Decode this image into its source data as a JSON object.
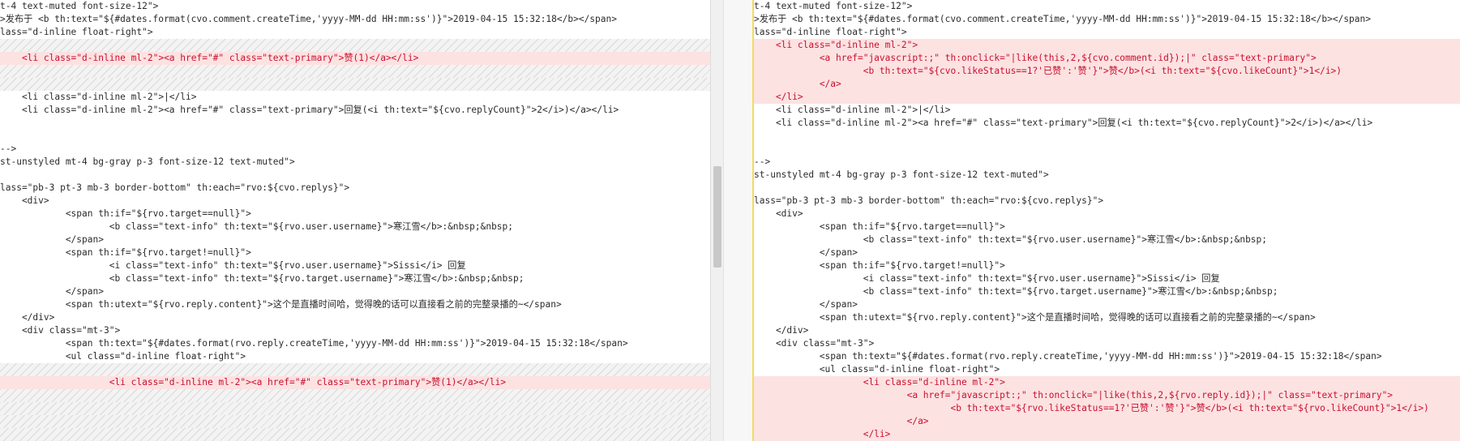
{
  "colors": {
    "changed_bg": "#fde2e2",
    "changed_text": "#c8102e",
    "divider": "#f2dc5d",
    "arrow": "#e7c23a"
  },
  "icons": {
    "merge_arrow_1": "arrow-left-icon",
    "merge_arrow_2": "arrow-left-icon"
  },
  "left": {
    "lines": [
      {
        "text": "t-4 text-muted font-size-12\">",
        "type": "normal"
      },
      {
        "text": ">发布于 <b th:text=\"${#dates.format(cvo.comment.createTime,'yyyy-MM-dd HH:mm:ss')}\">2019-04-15 15:32:18</b></span>",
        "type": "normal"
      },
      {
        "text": "lass=\"d-inline float-right\">",
        "type": "normal"
      },
      {
        "text": "",
        "type": "placeholder"
      },
      {
        "text": "    <li class=\"d-inline ml-2\"><a href=\"#\" class=\"text-primary\">赞(1)</a></li>",
        "type": "changed"
      },
      {
        "text": "",
        "type": "placeholder"
      },
      {
        "text": "",
        "type": "placeholder"
      },
      {
        "text": "    <li class=\"d-inline ml-2\">|</li>",
        "type": "normal"
      },
      {
        "text": "    <li class=\"d-inline ml-2\"><a href=\"#\" class=\"text-primary\">回复(<i th:text=\"${cvo.replyCount}\">2</i>)</a></li>",
        "type": "normal"
      },
      {
        "text": "",
        "type": "normal"
      },
      {
        "text": "",
        "type": "normal"
      },
      {
        "text": "-->",
        "type": "normal"
      },
      {
        "text": "st-unstyled mt-4 bg-gray p-3 font-size-12 text-muted\">",
        "type": "normal"
      },
      {
        "text": "",
        "type": "normal"
      },
      {
        "text": "lass=\"pb-3 pt-3 mb-3 border-bottom\" th:each=\"rvo:${cvo.replys}\">",
        "type": "normal"
      },
      {
        "text": "    <div>",
        "type": "normal"
      },
      {
        "text": "            <span th:if=\"${rvo.target==null}\">",
        "type": "normal"
      },
      {
        "text": "                    <b class=\"text-info\" th:text=\"${rvo.user.username}\">寒江雪</b>:&nbsp;&nbsp;",
        "type": "normal"
      },
      {
        "text": "            </span>",
        "type": "normal"
      },
      {
        "text": "            <span th:if=\"${rvo.target!=null}\">",
        "type": "normal"
      },
      {
        "text": "                    <i class=\"text-info\" th:text=\"${rvo.user.username}\">Sissi</i> 回复",
        "type": "normal"
      },
      {
        "text": "                    <b class=\"text-info\" th:text=\"${rvo.target.username}\">寒江雪</b>:&nbsp;&nbsp;",
        "type": "normal"
      },
      {
        "text": "            </span>",
        "type": "normal"
      },
      {
        "text": "            <span th:utext=\"${rvo.reply.content}\">这个是直播时间哈，觉得晚的话可以直接看之前的完整录播的~</span>",
        "type": "normal"
      },
      {
        "text": "    </div>",
        "type": "normal"
      },
      {
        "text": "    <div class=\"mt-3\">",
        "type": "normal"
      },
      {
        "text": "            <span th:text=\"${#dates.format(rvo.reply.createTime,'yyyy-MM-dd HH:mm:ss')}\">2019-04-15 15:32:18</span>",
        "type": "normal"
      },
      {
        "text": "            <ul class=\"d-inline float-right\">",
        "type": "normal"
      },
      {
        "text": "",
        "type": "placeholder"
      },
      {
        "text": "                    <li class=\"d-inline ml-2\"><a href=\"#\" class=\"text-primary\">赞(1)</a></li>",
        "type": "changed"
      },
      {
        "text": "",
        "type": "placeholder"
      },
      {
        "text": "",
        "type": "placeholder"
      },
      {
        "text": "",
        "type": "placeholder"
      },
      {
        "text": "",
        "type": "placeholder"
      }
    ]
  },
  "right": {
    "lines": [
      {
        "text": "t-4 text-muted font-size-12\">",
        "type": "normal"
      },
      {
        "text": ">发布于 <b th:text=\"${#dates.format(cvo.comment.createTime,'yyyy-MM-dd HH:mm:ss')}\">2019-04-15 15:32:18</b></span>",
        "type": "normal"
      },
      {
        "text": "lass=\"d-inline float-right\">",
        "type": "normal"
      },
      {
        "text": "    <li class=\"d-inline ml-2\">",
        "type": "changed"
      },
      {
        "text": "            <a href=\"javascript:;\" th:onclick=\"|like(this,2,${cvo.comment.id});|\" class=\"text-primary\">",
        "type": "changed"
      },
      {
        "text": "                    <b th:text=\"${cvo.likeStatus==1?'已赞':'赞'}\">赞</b>(<i th:text=\"${cvo.likeCount}\">1</i>)",
        "type": "changed"
      },
      {
        "text": "            </a>",
        "type": "changed"
      },
      {
        "text": "    </li>",
        "type": "changed"
      },
      {
        "text": "    <li class=\"d-inline ml-2\">|</li>",
        "type": "normal"
      },
      {
        "text": "    <li class=\"d-inline ml-2\"><a href=\"#\" class=\"text-primary\">回复(<i th:text=\"${cvo.replyCount}\">2</i>)</a></li>",
        "type": "normal"
      },
      {
        "text": "",
        "type": "normal"
      },
      {
        "text": "",
        "type": "normal"
      },
      {
        "text": "-->",
        "type": "normal"
      },
      {
        "text": "st-unstyled mt-4 bg-gray p-3 font-size-12 text-muted\">",
        "type": "normal"
      },
      {
        "text": "",
        "type": "normal"
      },
      {
        "text": "lass=\"pb-3 pt-3 mb-3 border-bottom\" th:each=\"rvo:${cvo.replys}\">",
        "type": "normal"
      },
      {
        "text": "    <div>",
        "type": "normal"
      },
      {
        "text": "            <span th:if=\"${rvo.target==null}\">",
        "type": "normal"
      },
      {
        "text": "                    <b class=\"text-info\" th:text=\"${rvo.user.username}\">寒江雪</b>:&nbsp;&nbsp;",
        "type": "normal"
      },
      {
        "text": "            </span>",
        "type": "normal"
      },
      {
        "text": "            <span th:if=\"${rvo.target!=null}\">",
        "type": "normal"
      },
      {
        "text": "                    <i class=\"text-info\" th:text=\"${rvo.user.username}\">Sissi</i> 回复",
        "type": "normal"
      },
      {
        "text": "                    <b class=\"text-info\" th:text=\"${rvo.target.username}\">寒江雪</b>:&nbsp;&nbsp;",
        "type": "normal"
      },
      {
        "text": "            </span>",
        "type": "normal"
      },
      {
        "text": "            <span th:utext=\"${rvo.reply.content}\">这个是直播时间哈，觉得晚的话可以直接看之前的完整录播的~</span>",
        "type": "normal"
      },
      {
        "text": "    </div>",
        "type": "normal"
      },
      {
        "text": "    <div class=\"mt-3\">",
        "type": "normal"
      },
      {
        "text": "            <span th:text=\"${#dates.format(rvo.reply.createTime,'yyyy-MM-dd HH:mm:ss')}\">2019-04-15 15:32:18</span>",
        "type": "normal"
      },
      {
        "text": "            <ul class=\"d-inline float-right\">",
        "type": "normal"
      },
      {
        "text": "                    <li class=\"d-inline ml-2\">",
        "type": "changed"
      },
      {
        "text": "                            <a href=\"javascript:;\" th:onclick=\"|like(this,2,${rvo.reply.id});|\" class=\"text-primary\">",
        "type": "changed"
      },
      {
        "text": "                                    <b th:text=\"${rvo.likeStatus==1?'已赞':'赞'}\">赞</b>(<i th:text=\"${rvo.likeCount}\">1</i>)",
        "type": "changed"
      },
      {
        "text": "                            </a>",
        "type": "changed"
      },
      {
        "text": "                    </li>",
        "type": "changed"
      }
    ]
  }
}
